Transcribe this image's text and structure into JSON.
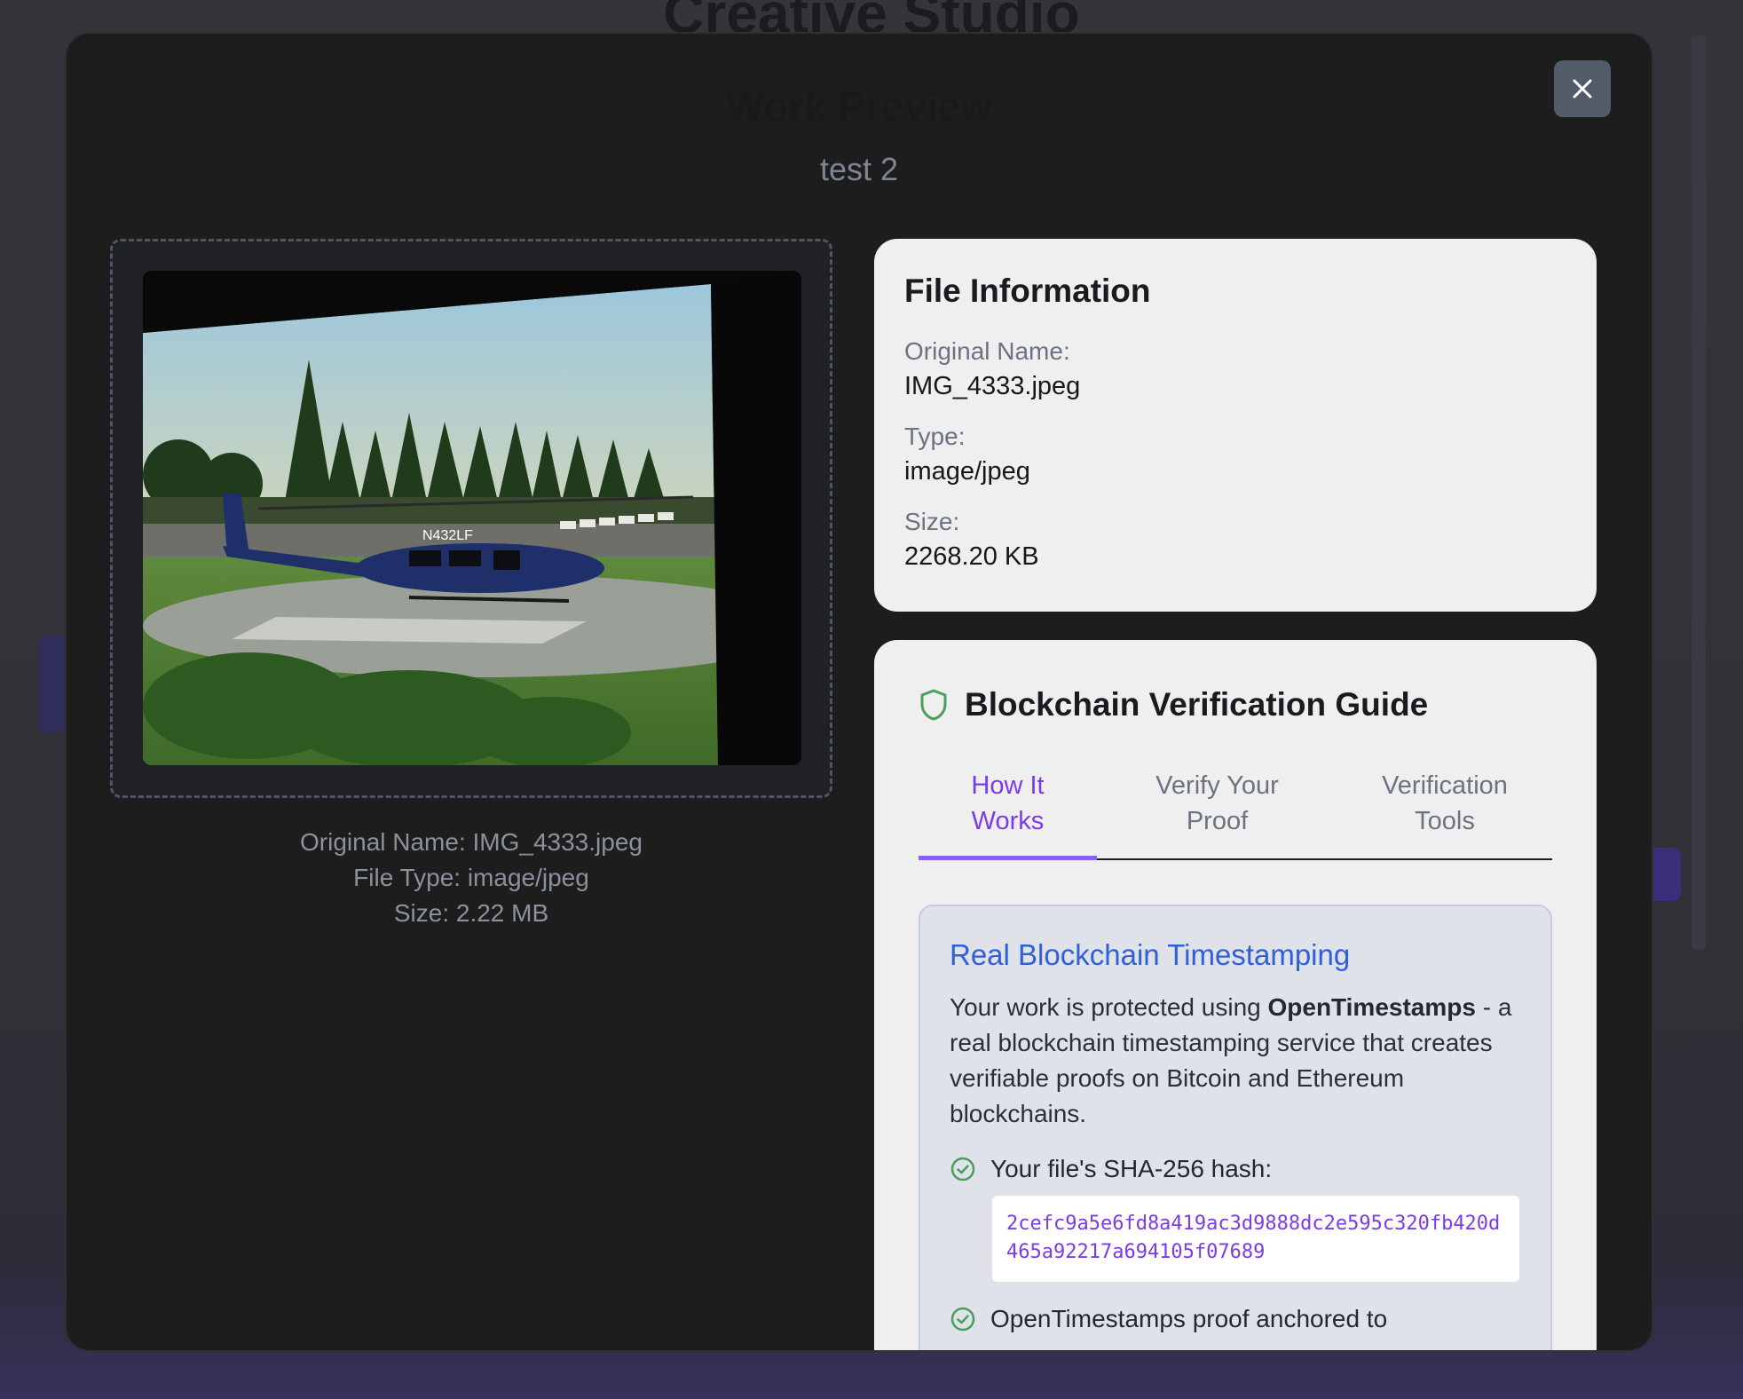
{
  "background": {
    "page_title": "Creative Studio"
  },
  "modal": {
    "title": "Work Preview",
    "subtitle": "test 2",
    "preview": {
      "image_description": "helicopter-on-helipad-photo",
      "helicopter_tail_number": "N432LF",
      "meta_original_name": "Original Name: IMG_4333.jpeg",
      "meta_file_type": "File Type: image/jpeg",
      "meta_size": "Size: 2.22 MB"
    },
    "file_info": {
      "title": "File Information",
      "fields": [
        {
          "label": "Original Name:",
          "value": "IMG_4333.jpeg"
        },
        {
          "label": "Type:",
          "value": "image/jpeg"
        },
        {
          "label": "Size:",
          "value": "2268.20 KB"
        }
      ]
    },
    "guide": {
      "title": "Blockchain Verification Guide",
      "tabs": [
        {
          "line1": "How It",
          "line2": "Works",
          "active": true
        },
        {
          "line1": "Verify Your",
          "line2": "Proof",
          "active": false
        },
        {
          "line1": "Verification",
          "line2": "Tools",
          "active": false
        }
      ],
      "panel": {
        "title": "Real Blockchain Timestamping",
        "text_before": "Your work is protected using ",
        "text_bold": "OpenTimestamps",
        "text_after": " - a real blockchain timestamping service that creates verifiable proofs on Bitcoin and Ethereum blockchains.",
        "check_hash_label": "Your file's SHA-256 hash:",
        "hash": "2cefc9a5e6fd8a419ac3d9888dc2e595c320fb420d465a92217a694105f07689",
        "check_anchor_label": "OpenTimestamps proof anchored to"
      }
    }
  },
  "colors": {
    "accent": "#7c3aed",
    "link_blue": "#2f5fd9",
    "success_green": "#4a9e5c",
    "modal_bg": "#1d1d1e"
  }
}
